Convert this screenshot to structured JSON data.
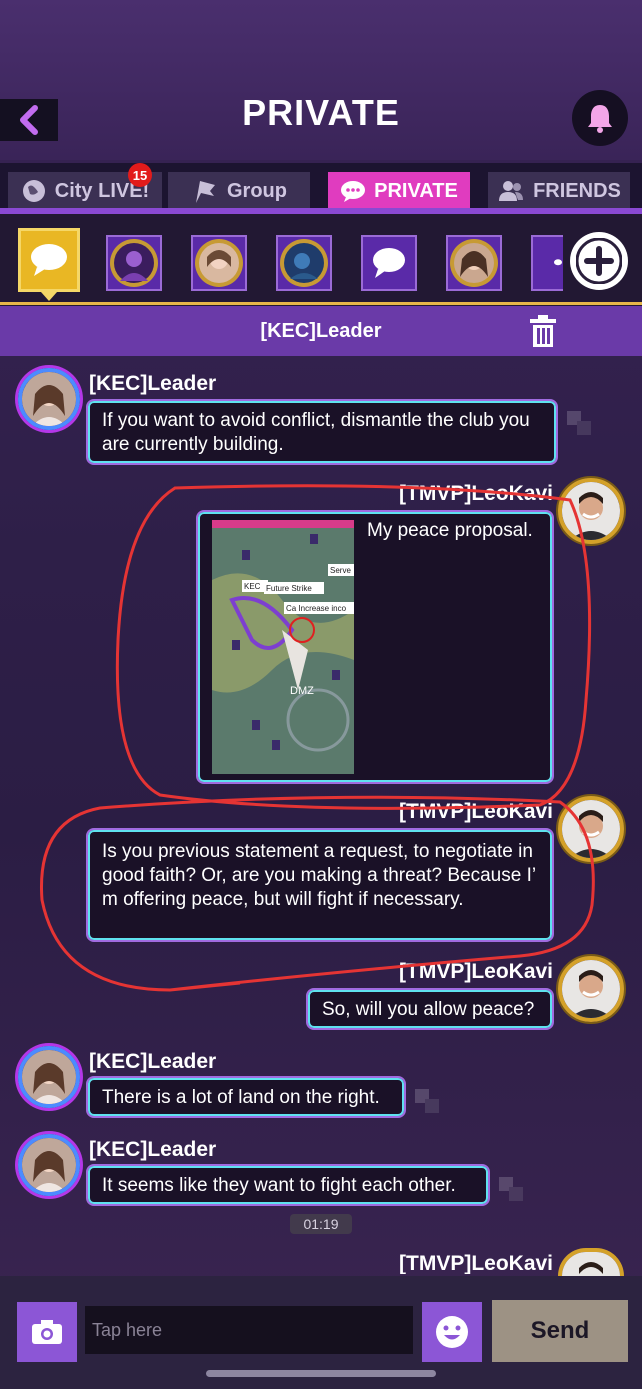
{
  "header": {
    "title": "PRIVATE",
    "back_icon": "chevron-left-icon",
    "bell_icon": "bell-icon"
  },
  "tabs": [
    {
      "label": "City LIVE!",
      "icon": "globe-icon",
      "badge": "15",
      "active": false
    },
    {
      "label": "Group",
      "icon": "flag-icon",
      "active": false
    },
    {
      "label": "PRIVATE",
      "icon": "chat-bubble-icon",
      "active": true
    },
    {
      "label": "FRIENDS",
      "icon": "people-icon",
      "active": false
    }
  ],
  "conversation": {
    "title": "[KEC]Leader"
  },
  "messages": [
    {
      "sender": "[KEC]Leader",
      "side": "left",
      "text": "If you want to avoid conflict, dismantle the club you are currently building."
    },
    {
      "sender": "[TMVP]LeoKavi",
      "side": "right",
      "text": "My peace proposal.",
      "map_labels": [
        "KEC",
        "Future Strike",
        "Serve",
        "Ca Increase inco",
        "DMZ"
      ]
    },
    {
      "sender": "[TMVP]LeoKavi",
      "side": "right",
      "text": "Is you previous statement a request, to negotiate in good faith? Or, are you making a threat? Because I’ m offering peace, but will fight if necessary."
    },
    {
      "sender": "[TMVP]LeoKavi",
      "side": "right",
      "text": "So, will you allow peace?"
    },
    {
      "sender": "[KEC]Leader",
      "side": "left",
      "text": "There is a lot of land on the right."
    },
    {
      "sender": "[KEC]Leader",
      "side": "left",
      "text": "It seems like they want to fight each other."
    },
    {
      "sender": "[TMVP]LeoKavi",
      "side": "right",
      "text": ""
    }
  ],
  "timestamp": "01:19",
  "input": {
    "placeholder": "Tap here",
    "value": "",
    "send_label": "Send"
  },
  "colors": {
    "accent": "#e03cbf",
    "bubble_border": "#5fe2ef",
    "annotation": "#e53434"
  }
}
